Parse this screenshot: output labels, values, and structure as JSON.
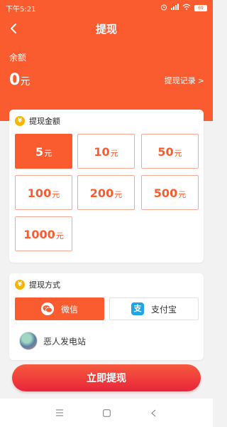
{
  "status_bar": {
    "time": "下午5:21",
    "battery": "69"
  },
  "nav": {
    "title": "提现"
  },
  "balance": {
    "label": "余额",
    "value": "0",
    "unit": "元",
    "record_link": "提现记录",
    "record_arrow": ">"
  },
  "amount_section": {
    "icon": "¥",
    "title": "提现金额",
    "unit": "元",
    "options": [
      "5",
      "10",
      "50",
      "100",
      "200",
      "500",
      "1000"
    ],
    "selected_index": 0
  },
  "method_section": {
    "icon": "¥",
    "title": "提现方式",
    "wechat_label": "微信",
    "alipay_label": "支付宝",
    "alipay_icon_char": "支",
    "selected": "wechat",
    "account_name": "恶人发电站"
  },
  "submit": {
    "label": "立即提现"
  },
  "colors": {
    "primary": "#fa5b2f",
    "submit_gradient_end": "#e8253a",
    "badge": "#f7b500",
    "alipay": "#1ea5e6"
  }
}
